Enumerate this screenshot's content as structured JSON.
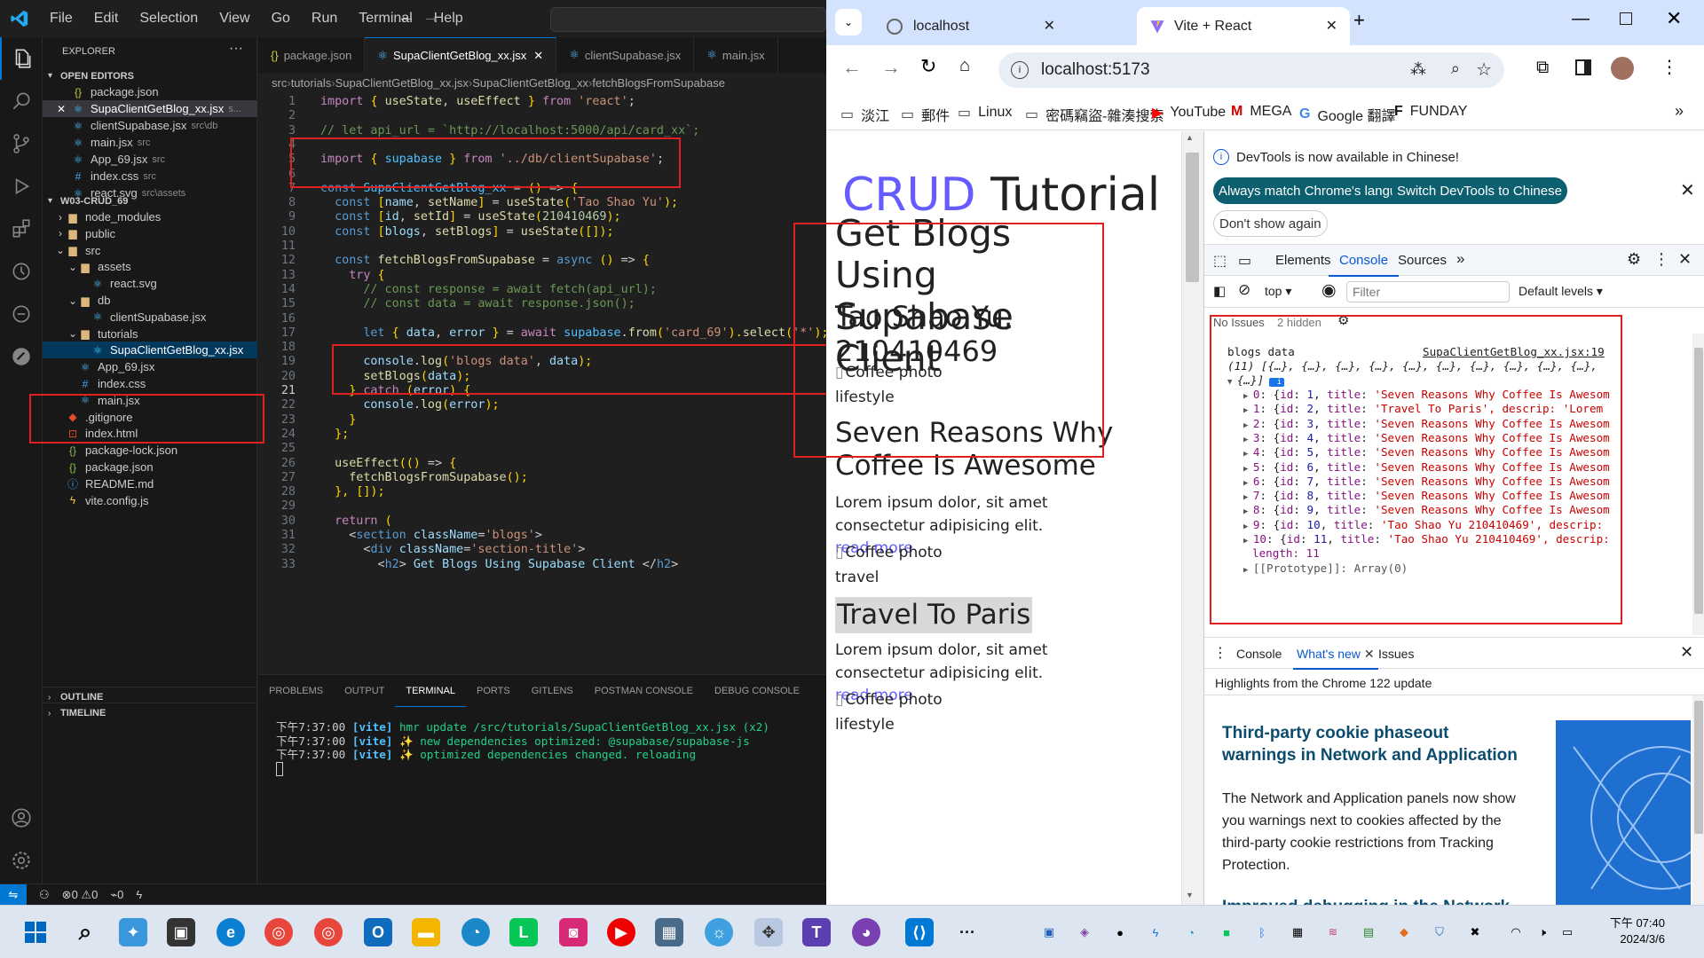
{
  "vscode": {
    "menu": [
      "File",
      "Edit",
      "Selection",
      "View",
      "Go",
      "Run",
      "Terminal",
      "Help"
    ],
    "sidebar": {
      "title": "EXPLORER",
      "open_editors_title": "OPEN EDITORS",
      "open_editors": [
        {
          "name": "package.json",
          "desc": ""
        },
        {
          "name": "SupaClientGetBlog_xx.jsx",
          "desc": "s..."
        },
        {
          "name": "clientSupabase.jsx",
          "desc": "src\\db"
        },
        {
          "name": "main.jsx",
          "desc": "src"
        },
        {
          "name": "App_69.jsx",
          "desc": "src"
        },
        {
          "name": "index.css",
          "desc": "src"
        },
        {
          "name": "react.svg",
          "desc": "src\\assets"
        }
      ],
      "project_title": "W03-CRUD_69",
      "tree": [
        {
          "name": "node_modules",
          "depth": 1,
          "kind": "folder-closed"
        },
        {
          "name": "public",
          "depth": 1,
          "kind": "folder-closed"
        },
        {
          "name": "src",
          "depth": 1,
          "kind": "folder-open"
        },
        {
          "name": "assets",
          "depth": 2,
          "kind": "folder-open"
        },
        {
          "name": "react.svg",
          "depth": 3,
          "kind": "react"
        },
        {
          "name": "db",
          "depth": 2,
          "kind": "folder-open"
        },
        {
          "name": "clientSupabase.jsx",
          "depth": 3,
          "kind": "react"
        },
        {
          "name": "tutorials",
          "depth": 2,
          "kind": "folder-open"
        },
        {
          "name": "SupaClientGetBlog_xx.jsx",
          "depth": 3,
          "kind": "react"
        },
        {
          "name": "App_69.jsx",
          "depth": 2,
          "kind": "react"
        },
        {
          "name": "index.css",
          "depth": 2,
          "kind": "css"
        },
        {
          "name": "main.jsx",
          "depth": 2,
          "kind": "react"
        },
        {
          "name": ".gitignore",
          "depth": 1,
          "kind": "git"
        },
        {
          "name": "index.html",
          "depth": 1,
          "kind": "html"
        },
        {
          "name": "package-lock.json",
          "depth": 1,
          "kind": "json"
        },
        {
          "name": "package.json",
          "depth": 1,
          "kind": "json"
        },
        {
          "name": "README.md",
          "depth": 1,
          "kind": "info"
        },
        {
          "name": "vite.config.js",
          "depth": 1,
          "kind": "vite"
        }
      ],
      "outline": "OUTLINE",
      "timeline": "TIMELINE"
    },
    "tabs": [
      "package.json",
      "SupaClientGetBlog_xx.jsx",
      "clientSupabase.jsx",
      "main.jsx"
    ],
    "breadcrumb": [
      "src",
      "tutorials",
      "SupaClientGetBlog_xx.jsx",
      "SupaClientGetBlog_xx",
      "fetchBlogsFromSupabase"
    ],
    "code": [
      "import { useState, useEffect } from 'react';",
      "",
      "// let api_url = `http://localhost:5000/api/card_xx`;",
      "",
      "import { supabase } from '../db/clientSupabase';",
      "",
      "const SupaClientGetBlog_xx = () => {",
      "  const [name, setName] = useState('Tao Shao Yu');",
      "  const [id, setId] = useState(210410469);",
      "  const [blogs, setBlogs] = useState([]);",
      "",
      "  const fetchBlogsFromSupabase = async () => {",
      "    try {",
      "      // const response = await fetch(api_url);",
      "      // const data = await response.json();",
      "",
      "      let { data, error } = await supabase.from('card_69').select('*');",
      "",
      "      console.log('blogs data', data);",
      "      setBlogs(data);",
      "    } catch (error) {",
      "      console.log(error);",
      "    }",
      "  };",
      "",
      "  useEffect(() => {",
      "    fetchBlogsFromSupabase();",
      "  }, []);",
      "",
      "  return (",
      "    <section className='blogs'>",
      "      <div className='section-title'>",
      "        <h2> Get Blogs Using Supabase Client </h2>"
    ],
    "active_line": "21",
    "panel_tabs": [
      "PROBLEMS",
      "OUTPUT",
      "TERMINAL",
      "PORTS",
      "GITLENS",
      "POSTMAN CONSOLE",
      "DEBUG CONSOLE"
    ],
    "terminal": [
      {
        "time": "下午7:37:00",
        "tag": "[vite]",
        "msg": "hmr update /src/tutorials/SupaClientGetBlog_xx.jsx (x2)"
      },
      {
        "time": "下午7:37:00",
        "tag": "[vite]",
        "msg": "✨ new dependencies optimized: @supabase/supabase-js"
      },
      {
        "time": "下午7:37:00",
        "tag": "[vite]",
        "msg": "✨ optimized dependencies changed. reloading"
      }
    ],
    "status": {
      "errors": "0",
      "warnings": "0",
      "ports": "0"
    }
  },
  "chrome": {
    "tabs": [
      {
        "title": "localhost"
      },
      {
        "title": "Vite + React"
      }
    ],
    "url": "localhost:5173",
    "bookmarks": [
      "淡江",
      "郵件",
      "Linux",
      "密碼竊盜-雜湊搜索",
      "YouTube",
      "MEGA",
      "Google 翻譯",
      "FUNDAY"
    ],
    "page": {
      "title_a": "CRUD",
      "title_b": "Tutorial",
      "section_title": "Get Blogs Using Supabase Client",
      "author": "Tao Shao Yu, 210410469",
      "blogs": [
        {
          "img_alt": "Coffee photo",
          "category": "lifestyle",
          "title": "Seven Reasons Why Coffee Is Awesome",
          "desc": "Lorem ipsum dolor, sit amet consectetur adipisicing elit.",
          "link": "read more"
        },
        {
          "img_alt": "Coffee photo",
          "category": "travel",
          "title": "Travel To Paris",
          "desc": "Lorem ipsum dolor, sit amet consectetur adipisicing elit.",
          "link": "read more"
        },
        {
          "img_alt": "Coffee photo",
          "category": "lifestyle",
          "title": "",
          "desc": "",
          "link": ""
        }
      ]
    },
    "devtools": {
      "banner": "DevTools is now available in Chinese!",
      "btn_match": "Always match Chrome's language",
      "btn_switch": "Switch DevTools to Chinese",
      "btn_dont": "Don't show again",
      "tabs": [
        "Elements",
        "Console",
        "Sources"
      ],
      "context": "top",
      "filter_placeholder": "Filter",
      "levels": "Default levels",
      "issues": "No Issues",
      "hidden": "2 hidden",
      "log_label": "blogs data",
      "log_source": "SupaClientGetBlog_xx.jsx:19",
      "array_summary": "(11) [{…}, {…}, {…}, {…}, {…}, {…}, {…}, {…}, {…}, {…},",
      "array_summary2": "{…}]",
      "entries": [
        {
          "idx": "0",
          "id": "1",
          "title": "'Seven Reasons Why Coffee Is Awesom"
        },
        {
          "idx": "1",
          "id": "2",
          "title": "'Travel To Paris', descrip: 'Lorem"
        },
        {
          "idx": "2",
          "id": "3",
          "title": "'Seven Reasons Why Coffee Is Awesom"
        },
        {
          "idx": "3",
          "id": "4",
          "title": "'Seven Reasons Why Coffee Is Awesom"
        },
        {
          "idx": "4",
          "id": "5",
          "title": "'Seven Reasons Why Coffee Is Awesom"
        },
        {
          "idx": "5",
          "id": "6",
          "title": "'Seven Reasons Why Coffee Is Awesom"
        },
        {
          "idx": "6",
          "id": "7",
          "title": "'Seven Reasons Why Coffee Is Awesom"
        },
        {
          "idx": "7",
          "id": "8",
          "title": "'Seven Reasons Why Coffee Is Awesom"
        },
        {
          "idx": "8",
          "id": "9",
          "title": "'Seven Reasons Why Coffee Is Awesom"
        },
        {
          "idx": "9",
          "id": "10",
          "title": "'Tao Shao Yu 210410469', descrip:"
        },
        {
          "idx": "10",
          "id": "11",
          "title": "'Tao Shao Yu 210410469', descrip:"
        }
      ],
      "length_label": "length: 11",
      "prototype": "[[Prototype]]: Array(0)",
      "drawer_tabs": [
        "Console",
        "What's new",
        "Issues"
      ],
      "whatsnew_header": "Highlights from the Chrome 122 update",
      "whatsnew_title": "Third-party cookie phaseout warnings in Network and Application",
      "whatsnew_body": "The Network and Application panels now show you warnings next to cookies affected by the third-party cookie restrictions from Tracking Protection.",
      "whatsnew_next": "Improved debugging in the Network"
    }
  },
  "taskbar": {
    "time": "下午 07:40",
    "date": "2024/3/6"
  }
}
